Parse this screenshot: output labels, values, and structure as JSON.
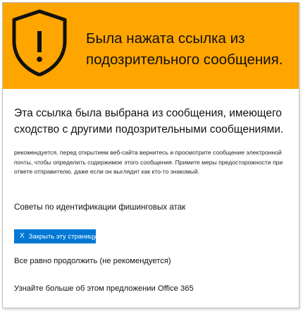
{
  "banner": {
    "icon": "shield-warning-icon",
    "title": "Была нажата ссылка из подозрительного сообщения.",
    "background_color": "#ffa500",
    "shield_color": "#111111"
  },
  "headline": "Эта ссылка была выбрана из сообщения, имеющего сходство с другими подозрительными сообщениями.",
  "body_text": "рекомендуется. перед открытием веб-сайта вернитесь и просмотрите сообщение электронной почты, чтобы определить содержимое этого сообщения. Примите меры предосторожности при ответе отправителю. даже если он выглядит как кто-то знакомый.",
  "links": {
    "tips": "Советы по идентификации фишинговых атак",
    "continue": "Все равно продолжить (не рекомендуется)",
    "learn_more": "Узнайте больше об этом предложении Office 365"
  },
  "close_button": {
    "icon": "close-icon",
    "glyph": "X",
    "label": "Закрыть эту страницу",
    "color": "#0078d4"
  }
}
